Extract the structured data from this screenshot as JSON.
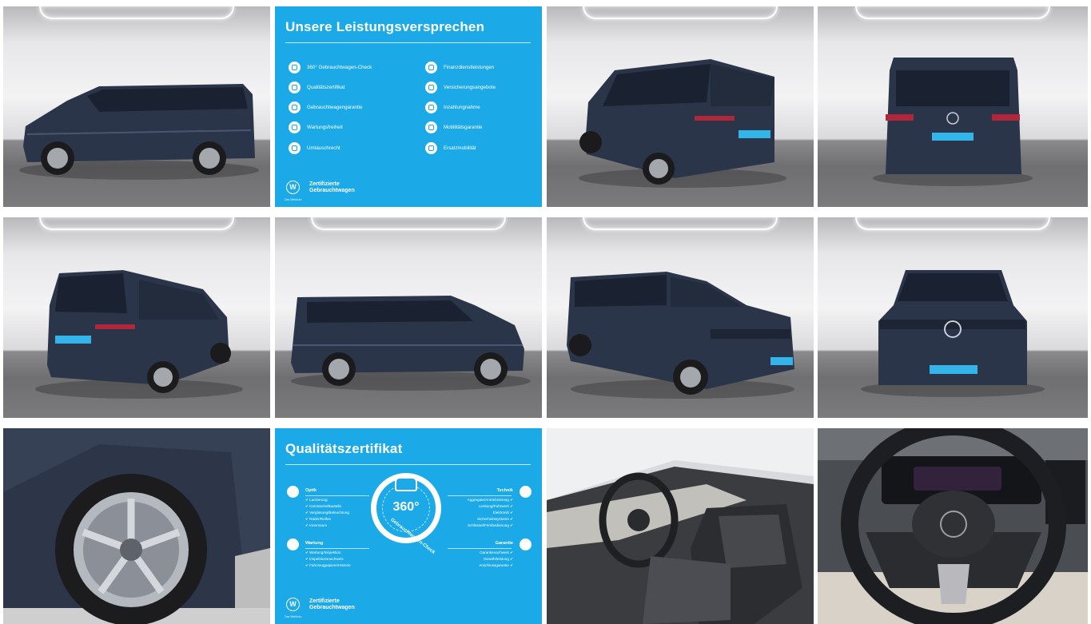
{
  "gallery": {
    "tiles": [
      {
        "id": "side-left-view",
        "kind": "photo"
      },
      {
        "id": "leistungsversprechen-panel",
        "kind": "info"
      },
      {
        "id": "rear-three-quarter-view",
        "kind": "photo"
      },
      {
        "id": "rear-view",
        "kind": "photo"
      },
      {
        "id": "rear-left-three-quarter-view",
        "kind": "photo"
      },
      {
        "id": "side-right-view",
        "kind": "photo"
      },
      {
        "id": "front-three-quarter-view",
        "kind": "photo"
      },
      {
        "id": "front-view",
        "kind": "photo"
      },
      {
        "id": "wheel-closeup",
        "kind": "photo"
      },
      {
        "id": "qualitaetszertifikat-panel",
        "kind": "info"
      },
      {
        "id": "interior-cockpit",
        "kind": "photo"
      },
      {
        "id": "steering-wheel",
        "kind": "photo"
      }
    ]
  },
  "colors": {
    "panel_blue": "#1ba9e8",
    "car_paint": "#2b3549"
  },
  "promises": {
    "title": "Unsere Leistungsversprechen",
    "left": [
      "360° Gebrauchtwagen-Check",
      "Qualitätszertifikat",
      "Gebrauchtwagengarantie",
      "Wartungsfreiheit",
      "Umtauschrecht"
    ],
    "right": [
      "Finanzdienstleistungen",
      "Versicherungsangebote",
      "Inzahlungnahme",
      "Mobilitätsgarantie",
      "Ersatzmobilität"
    ],
    "brand_line1": "Zertifizierte",
    "brand_line2": "Gebrauchtwagen",
    "brand_sub": "Das WeltAuto"
  },
  "certificate": {
    "title": "Qualitätszertifikat",
    "optik": "Optik",
    "wartung": "Wartung",
    "technik": "Technik",
    "garantie": "Garantie",
    "badge_number": "360°",
    "badge_text": "Gebrauchtwagen-Check",
    "optik_items": [
      "✔ Lackierung",
      "✔ Karosserie/Bauteile",
      "✔ Verglasung/Beleuchtung",
      "✔ Räder/Reifen",
      "✔ Innenraum"
    ],
    "technik_items": [
      "Aggregate/Antriebsstrang ✔",
      "Lenkung/Fahrwerk ✔",
      "Elektronik ✔",
      "Sicherheitssysteme ✔",
      "Schlüssel/Fernbedienung ✔"
    ],
    "wartung_items": [
      "✔ Wartung/Inspektion",
      "✔ Inspektionsnachweis",
      "✔ Fahrzeugpapiere/Historie"
    ],
    "garantie_items": [
      "Garantienachweis ✔",
      "Gewährleistung ✔",
      "Anschlussgarantie ✔"
    ],
    "brand_line1": "Zertifizierte",
    "brand_line2": "Gebrauchtwagen",
    "brand_sub": "Das WeltAuto"
  }
}
